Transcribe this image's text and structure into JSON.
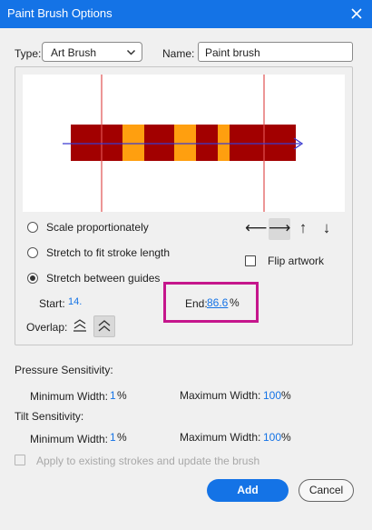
{
  "window": {
    "title": "Paint Brush Options"
  },
  "type": {
    "label": "Type:",
    "value": "Art Brush"
  },
  "name": {
    "label": "Name:",
    "value": "Paint brush"
  },
  "preview": {
    "guide_color": "#e05050",
    "segment_colors": {
      "dark_red": "#a20000",
      "orange": "#ff9f0f"
    },
    "direction_arrow_color": "#3a3ad0"
  },
  "scaling": {
    "options": [
      {
        "label": "Scale proportionately",
        "checked": false
      },
      {
        "label": "Stretch to fit stroke length",
        "checked": false
      },
      {
        "label": "Stretch between guides",
        "checked": true
      }
    ],
    "start_label": "Start:",
    "start_value": "14.",
    "end_label": "End:",
    "end_value": "86.6",
    "end_unit": "%"
  },
  "direction": {
    "buttons": [
      {
        "glyph": "⟵",
        "icon": "arrow-left-icon",
        "active": false
      },
      {
        "glyph": "⟶",
        "icon": "arrow-right-icon",
        "active": true
      },
      {
        "glyph": "↑",
        "icon": "arrow-up-icon",
        "active": false
      },
      {
        "glyph": "↓",
        "icon": "arrow-down-icon",
        "active": false
      }
    ]
  },
  "flip": {
    "label": "Flip artwork",
    "checked": false
  },
  "overlap": {
    "label": "Overlap:"
  },
  "pressure": {
    "title": "Pressure Sensitivity:",
    "min_label": "Minimum Width:",
    "min_value": "1",
    "max_label": "Maximum Width:",
    "max_value": "100",
    "unit": "%"
  },
  "tilt": {
    "title": "Tilt Sensitivity:",
    "min_label": "Minimum Width:",
    "min_value": "1",
    "max_label": "Maximum Width:",
    "max_value": "100",
    "unit": "%"
  },
  "apply_existing": {
    "label": "Apply to existing strokes and update the brush",
    "checked": false,
    "disabled": true
  },
  "buttons": {
    "add": "Add",
    "cancel": "Cancel"
  },
  "colors": {
    "accent": "#1473e6",
    "highlight": "#c5168c"
  }
}
